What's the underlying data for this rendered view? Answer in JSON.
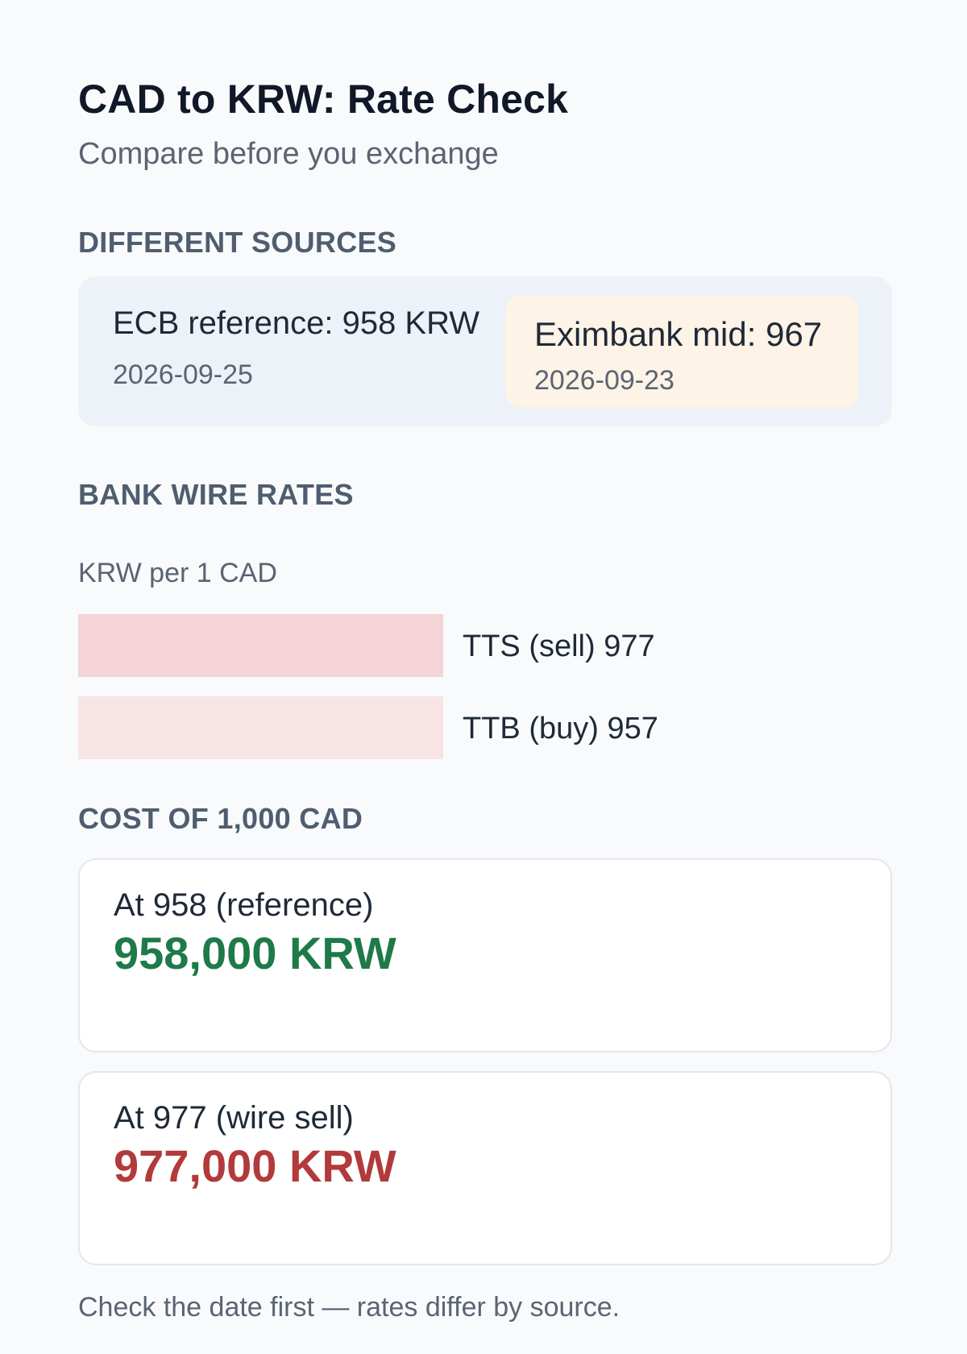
{
  "header": {
    "title": "CAD to KRW: Rate Check",
    "subtitle": "Compare before you exchange"
  },
  "sources": {
    "heading": "DIFFERENT SOURCES",
    "ecb": {
      "label": "ECB reference: 958 KRW",
      "date": "2026-09-25"
    },
    "eximbank": {
      "label": "Eximbank mid: 967",
      "date": "2026-09-23"
    }
  },
  "wire": {
    "heading": "BANK WIRE RATES",
    "caption": "KRW per 1 CAD"
  },
  "chart_data": {
    "type": "bar",
    "orientation": "horizontal",
    "unit": "KRW per 1 CAD",
    "bars": [
      {
        "label": "TTS (sell) 977",
        "name": "TTS (sell)",
        "value": 977,
        "color": "#f4d4d6"
      },
      {
        "label": "TTB (buy) 957",
        "name": "TTB (buy)",
        "value": 957,
        "color": "#f8e4e5"
      }
    ]
  },
  "cost": {
    "heading": "COST OF 1,000 CAD",
    "reference": {
      "label": "At 958 (reference)",
      "value": "958,000 KRW"
    },
    "wire_sell": {
      "label": "At 977 (wire sell)",
      "value": "977,000 KRW"
    }
  },
  "colors": {
    "positive": "#1e7a48",
    "negative": "#b23a3a",
    "sources_bg": "#edf2f9",
    "highlight_bg": "#fdf3e6"
  },
  "footer": {
    "note": "Check the date first — rates differ by source."
  }
}
